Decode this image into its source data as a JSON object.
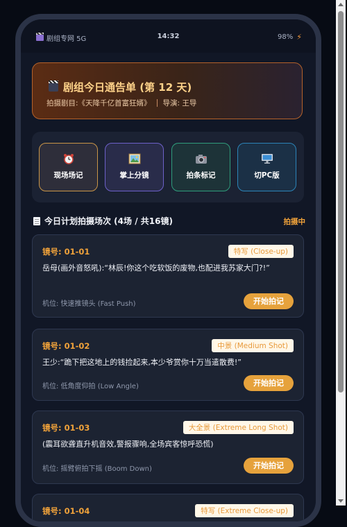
{
  "status_bar": {
    "carrier": "剧组专网 5G",
    "time": "14:32",
    "battery": "98%"
  },
  "notice": {
    "title": "剧组今日通告单 (第 12 天)",
    "project": "拍摄剧目:《天降千亿首富狂婿》",
    "director": "导演: 王导"
  },
  "actions": [
    {
      "label": "现场场记",
      "icon": "alarm-clock-icon"
    },
    {
      "label": "掌上分镜",
      "icon": "picture-icon"
    },
    {
      "label": "拍条标记",
      "icon": "camera-icon"
    },
    {
      "label": "切PC版",
      "icon": "desktop-icon"
    }
  ],
  "schedule": {
    "title": "今日计划拍摄场次 (4场 / 共16镜)",
    "status": "拍摄中"
  },
  "shots": [
    {
      "number": "镜号: 01-01",
      "type": "特写 (Close-up)",
      "line": "岳母(画外音怒吼):“林辰!你这个吃软饭的废物,也配进我苏家大门?!”",
      "position": "机位: 快速推镜头 (Fast Push)",
      "button": "开始拍记"
    },
    {
      "number": "镜号: 01-02",
      "type": "中景 (Medium Shot)",
      "line": "王少:“跪下把这地上的钱捡起来,本少爷赏你十万当遣散费!”",
      "position": "机位: 低角度仰拍 (Low Angle)",
      "button": "开始拍记"
    },
    {
      "number": "镜号: 01-03",
      "type": "大全景 (Extreme Long Shot)",
      "line": "(震耳欲聋直升机音效,警报骤响,全场宾客惊呼恐慌)",
      "position": "机位: 摇臂俯拍下摇 (Boom Down)",
      "button": "开始拍记"
    },
    {
      "number": "镜号: 01-04",
      "type": "特写 (Extreme Close-up)"
    }
  ],
  "colors": {
    "accent": "#f0a23a",
    "button": "#e6a23c",
    "badge_bg": "#fff7e8"
  }
}
